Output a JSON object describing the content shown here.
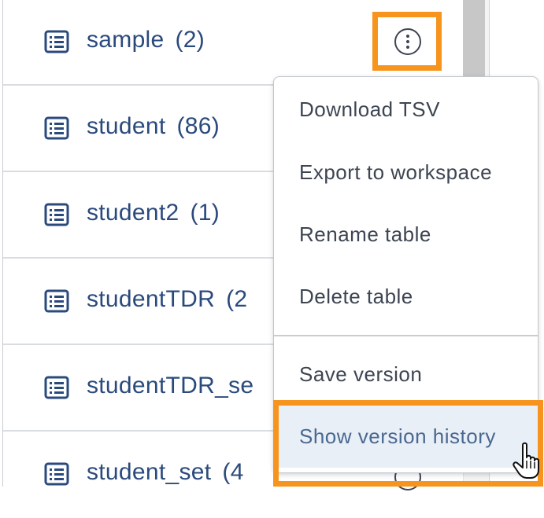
{
  "tables": [
    {
      "name": "sample",
      "count": "(2)"
    },
    {
      "name": "student",
      "count": "(86)"
    },
    {
      "name": "student2",
      "count": "(1)"
    },
    {
      "name": "studentTDR",
      "count": "(2"
    },
    {
      "name": "studentTDR_se",
      "count": ""
    },
    {
      "name": "student_set",
      "count": "(4"
    }
  ],
  "icons": {
    "table": "table-list-icon",
    "kebab": "vertical-ellipsis-icon",
    "cursor": "hand-pointer-cursor"
  },
  "menu": {
    "items": [
      {
        "label": "Download TSV"
      },
      {
        "label": "Export to workspace"
      },
      {
        "label": "Rename table"
      },
      {
        "label": "Delete table"
      },
      {
        "label": "Save version"
      },
      {
        "label": "Show version history"
      }
    ]
  },
  "colors": {
    "highlight": "#f7941d",
    "link_text": "#2b4a7c",
    "menu_text": "#3d4552"
  }
}
